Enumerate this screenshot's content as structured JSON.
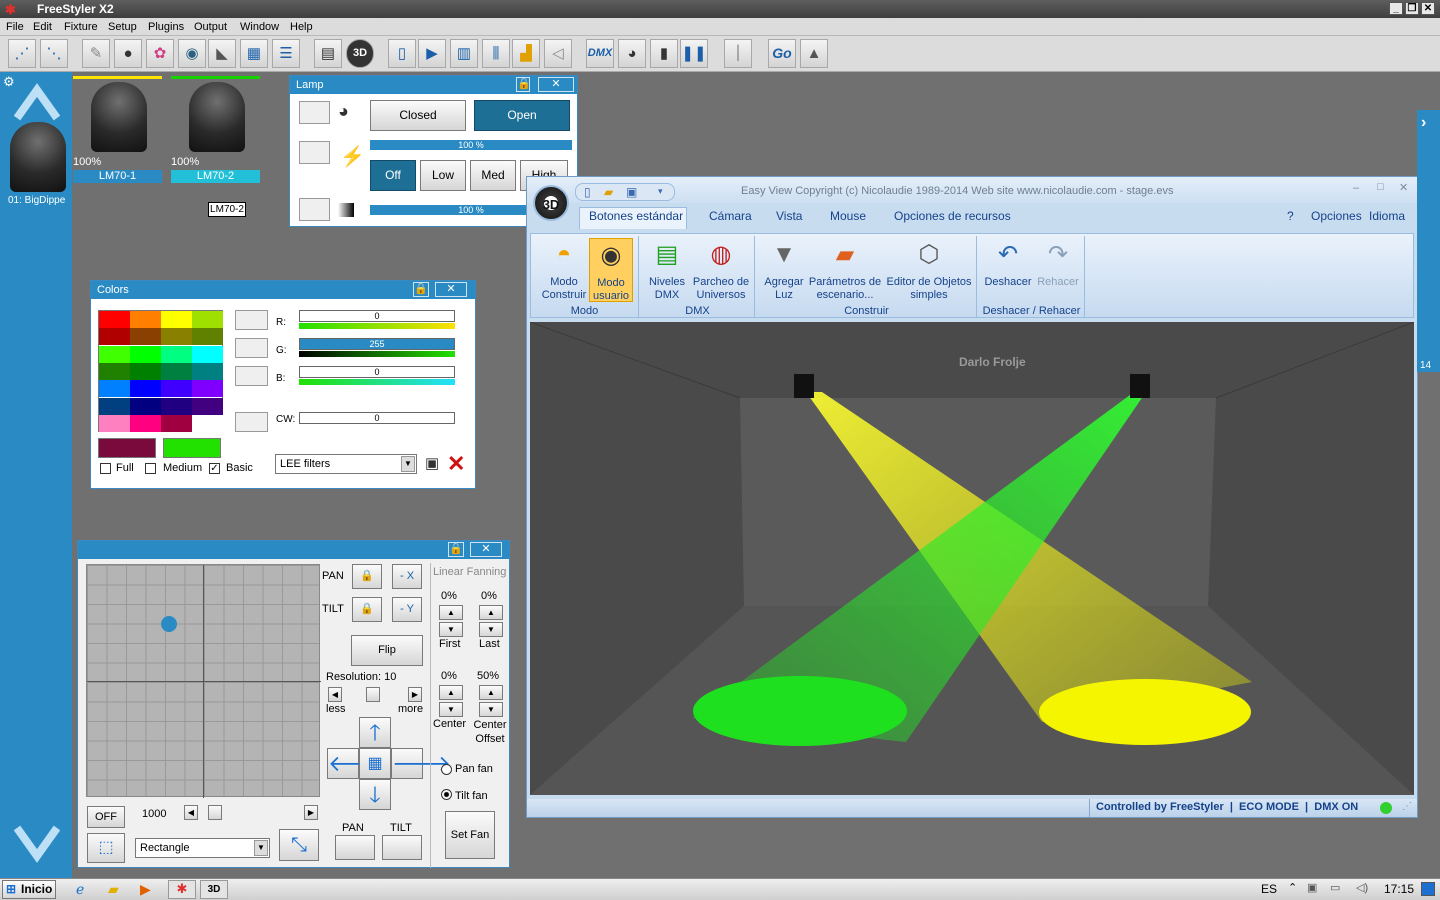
{
  "app": {
    "title": "FreeStyler X2"
  },
  "menu": [
    "File",
    "Edit",
    "Fixture",
    "Setup",
    "Plugins",
    "Output",
    "Window",
    "Help"
  ],
  "toolbar": {
    "icons": [
      "fixture-select-icon",
      "group-icon",
      "pen-icon",
      "gobo-icon",
      "color-wheel-icon",
      "moving-head-icon",
      "shape-icon",
      "grid-icon",
      "list-icon",
      "submaster-icon",
      "3d-icon",
      "new-file-icon",
      "play-icon",
      "grid-2-icon",
      "faders-icon",
      "levels-icon",
      "beam-icon",
      "dmx-icon",
      "lamp-icon",
      "fog-icon",
      "pause-icon",
      "master-icon"
    ],
    "dmx_label": "DMX",
    "go_label": "Go",
    "threed_label": "3D"
  },
  "left_panel": {
    "fixture_label": "01: BigDippe"
  },
  "fixtures": [
    {
      "name": "LM70-1",
      "percent": "100%",
      "accent": "#ffe600"
    },
    {
      "name": "LM70-2",
      "percent": "100%",
      "accent": "#18d200"
    }
  ],
  "tooltip": "LM70-2",
  "lamp": {
    "title": "Lamp",
    "closed": "Closed",
    "open": "Open",
    "bar1": "100 %",
    "off": "Off",
    "low": "Low",
    "med": "Med",
    "high": "High",
    "bar2": "100 %"
  },
  "colors": {
    "title": "Colors",
    "r_label": "R:",
    "g_label": "G:",
    "b_label": "B:",
    "cw_label": "CW:",
    "r_value": "0",
    "g_value": "255",
    "b_value": "0",
    "cw_value": "0",
    "full": "Full",
    "medium": "Medium",
    "basic": "Basic",
    "filter": "LEE filters",
    "swatch_a": "#7a0a3c",
    "swatch_b": "#22e000",
    "palette": [
      [
        "#ff0000",
        "#ff8000",
        "#ffff00",
        "#a0e000"
      ],
      [
        "#b00000",
        "#8a4000",
        "#8a8000",
        "#608000"
      ],
      [
        "#40ff00",
        "#00ff00",
        "#00ff80",
        "#00ffff"
      ],
      [
        "#208000",
        "#008000",
        "#008040",
        "#008080"
      ],
      [
        "#0080ff",
        "#0000ff",
        "#4000ff",
        "#8000ff"
      ],
      [
        "#004080",
        "#000080",
        "#200080",
        "#400080"
      ],
      [
        "#ff80c0",
        "#ff0080",
        "#a00040",
        "#ffffff"
      ]
    ]
  },
  "movement": {
    "pan": "PAN",
    "tilt": "TILT",
    "minus_x": "- X",
    "minus_y": "- Y",
    "flip": "Flip",
    "resolution": "Resolution: 10",
    "less": "less",
    "more": "more",
    "off": "OFF",
    "speed_value": "1000",
    "shape": "Rectangle",
    "pan_bottom": "PAN",
    "tilt_bottom": "TILT",
    "fanning_title": "Linear Fanning",
    "first_pct": "0%",
    "last_pct": "0%",
    "first": "First",
    "last": "Last",
    "center_pct": "0%",
    "offset_pct": "50%",
    "center": "Center",
    "center_offset": "Center Offset",
    "pan_fan": "Pan fan",
    "tilt_fan": "Tilt fan",
    "set_fan": "Set Fan"
  },
  "easyview": {
    "title": "Easy View   Copyright (c) Nicolaudie 1989-2014   Web site www.nicolaudie.com - stage.evs",
    "logo": "3D",
    "tabs": [
      "Botones estándar",
      "Cámara",
      "Vista",
      "Mouse",
      "Opciones de recursos"
    ],
    "help": "?",
    "options": "Opciones",
    "language": "Idioma",
    "groups": [
      {
        "name": "Modo",
        "buttons": [
          {
            "label": "Modo Construir",
            "icon": "helmet-icon"
          },
          {
            "label": "Modo usuario",
            "icon": "eye-icon"
          }
        ]
      },
      {
        "name": "DMX",
        "buttons": [
          {
            "label": "Niveles DMX",
            "icon": "levels-icon"
          },
          {
            "label": "Parcheo de Universos",
            "icon": "dmx-patch-icon"
          }
        ]
      },
      {
        "name": "Construir",
        "buttons": [
          {
            "label": "Agregar Luz",
            "icon": "light-icon"
          },
          {
            "label": "Parámetros de escenario...",
            "icon": "stage-icon"
          },
          {
            "label": "Editor de Objetos simples",
            "icon": "cube-icon"
          }
        ]
      },
      {
        "name": "Deshacer / Rehacer",
        "buttons": [
          {
            "label": "Deshacer",
            "icon": "undo-icon"
          },
          {
            "label": "Rehacer",
            "icon": "redo-icon"
          }
        ]
      }
    ],
    "watermark": "Darlo Frolje",
    "status": "Controlled by FreeStyler  |  ECO MODE  |  DMX ON"
  },
  "side_number": "14",
  "taskbar": {
    "start": "Inicio",
    "lang": "ES",
    "clock": "17:15"
  }
}
